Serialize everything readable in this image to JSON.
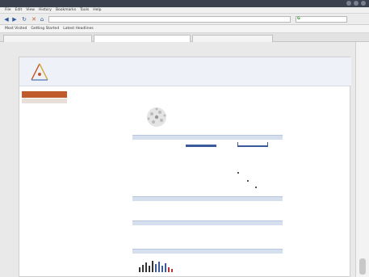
{
  "window": {
    "title": "",
    "colors": {
      "titlebar": "#3c4150",
      "accent": "#c05a2a",
      "header_bg": "#eef2f8",
      "section_bg": "#d6dfee"
    }
  },
  "menu": [
    "File",
    "Edit",
    "View",
    "History",
    "Bookmarks",
    "Tools",
    "Help"
  ],
  "nav": {
    "back_icon": "back-arrow-icon",
    "forward_icon": "forward-arrow-icon",
    "reload_icon": "reload-icon",
    "home_icon": "home-icon",
    "url": "",
    "search_placeholder": ""
  },
  "bookmarks": [
    "Most Visited",
    "Getting Started",
    "Latest Headlines"
  ],
  "tabs": [
    {
      "label": ""
    },
    {
      "label": ""
    },
    {
      "label": ""
    }
  ],
  "page": {
    "header_title": "",
    "header_subtitle": "",
    "sidebar": {
      "heading": "",
      "sub": "",
      "links": [
        "",
        "",
        "",
        ""
      ]
    },
    "antibody": {
      "lines": [
        {
          "key": "",
          "val": ""
        },
        {
          "key": "",
          "val": ""
        },
        {
          "key": "",
          "val": ""
        },
        {
          "key": "",
          "val": ""
        },
        {
          "key": "",
          "val": ""
        },
        {
          "key": "",
          "val": ""
        }
      ]
    },
    "sections": [
      "",
      "",
      "",
      "",
      ""
    ],
    "validation": {
      "row_labels": [
        "",
        ""
      ],
      "lane_labels": [
        "",
        ""
      ]
    },
    "text_lines": [
      "",
      "",
      "",
      ""
    ],
    "links": [
      "",
      "",
      ""
    ]
  }
}
